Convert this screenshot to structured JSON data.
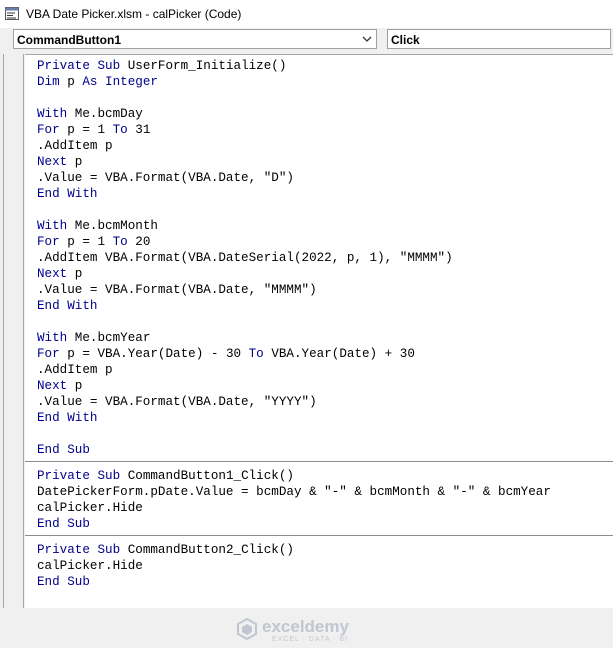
{
  "window": {
    "title": "VBA Date Picker.xlsm - calPicker (Code)"
  },
  "toolbar": {
    "object_combo": {
      "value": "CommandButton1"
    },
    "procedure_combo": {
      "value": "Click"
    }
  },
  "code": {
    "procedures": [
      {
        "lines": [
          [
            {
              "t": "Private Sub ",
              "k": true
            },
            {
              "t": "UserForm_Initialize()",
              "k": false
            }
          ],
          [
            {
              "t": "Dim ",
              "k": true
            },
            {
              "t": "p ",
              "k": false
            },
            {
              "t": "As Integer",
              "k": true
            }
          ],
          [],
          [
            {
              "t": "With ",
              "k": true
            },
            {
              "t": "Me.bcmDay",
              "k": false
            }
          ],
          [
            {
              "t": "For ",
              "k": true
            },
            {
              "t": "p = 1 ",
              "k": false
            },
            {
              "t": "To ",
              "k": true
            },
            {
              "t": "31",
              "k": false
            }
          ],
          [
            {
              "t": ".AddItem p",
              "k": false
            }
          ],
          [
            {
              "t": "Next ",
              "k": true
            },
            {
              "t": "p",
              "k": false
            }
          ],
          [
            {
              "t": ".Value = VBA.Format(VBA.Date, \"D\")",
              "k": false
            }
          ],
          [
            {
              "t": "End With",
              "k": true
            }
          ],
          [],
          [
            {
              "t": "With ",
              "k": true
            },
            {
              "t": "Me.bcmMonth",
              "k": false
            }
          ],
          [
            {
              "t": "For ",
              "k": true
            },
            {
              "t": "p = 1 ",
              "k": false
            },
            {
              "t": "To ",
              "k": true
            },
            {
              "t": "20",
              "k": false
            }
          ],
          [
            {
              "t": ".AddItem VBA.Format(VBA.DateSerial(2022, p, 1), \"MMMM\")",
              "k": false
            }
          ],
          [
            {
              "t": "Next ",
              "k": true
            },
            {
              "t": "p",
              "k": false
            }
          ],
          [
            {
              "t": ".Value = VBA.Format(VBA.Date, \"MMMM\")",
              "k": false
            }
          ],
          [
            {
              "t": "End With",
              "k": true
            }
          ],
          [],
          [
            {
              "t": "With ",
              "k": true
            },
            {
              "t": "Me.bcmYear",
              "k": false
            }
          ],
          [
            {
              "t": "For ",
              "k": true
            },
            {
              "t": "p = VBA.Year(Date) - 30 ",
              "k": false
            },
            {
              "t": "To ",
              "k": true
            },
            {
              "t": "VBA.Year(Date) + 30",
              "k": false
            }
          ],
          [
            {
              "t": ".AddItem p",
              "k": false
            }
          ],
          [
            {
              "t": "Next ",
              "k": true
            },
            {
              "t": "p",
              "k": false
            }
          ],
          [
            {
              "t": ".Value = VBA.Format(VBA.Date, \"YYYY\")",
              "k": false
            }
          ],
          [
            {
              "t": "End With",
              "k": true
            }
          ],
          [],
          [
            {
              "t": "End Sub",
              "k": true
            }
          ]
        ]
      },
      {
        "lines": [
          [
            {
              "t": "Private Sub ",
              "k": true
            },
            {
              "t": "CommandButton1_Click()",
              "k": false
            }
          ],
          [
            {
              "t": "DatePickerForm.pDate.Value = bcmDay & \"-\" & bcmMonth & \"-\" & bcmYear",
              "k": false
            }
          ],
          [
            {
              "t": "calPicker.Hide",
              "k": false
            }
          ],
          [
            {
              "t": "End Sub",
              "k": true
            }
          ]
        ]
      },
      {
        "lines": [
          [
            {
              "t": "Private Sub ",
              "k": true
            },
            {
              "t": "CommandButton2_Click()",
              "k": false
            }
          ],
          [
            {
              "t": "calPicker.Hide",
              "k": false
            }
          ],
          [
            {
              "t": "End Sub",
              "k": true
            }
          ]
        ]
      }
    ]
  },
  "watermark": {
    "name": "exceldemy",
    "tagline": "EXCEL · DATA · BI"
  },
  "colors": {
    "keyword": "#00008b",
    "text": "#000000"
  }
}
